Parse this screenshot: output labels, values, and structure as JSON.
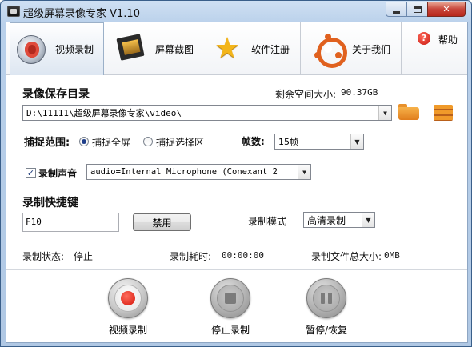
{
  "window": {
    "title": "超级屏幕录像专家 V1.10",
    "close_label": "✕"
  },
  "tabs": [
    {
      "label": "视频录制",
      "icon": "video-record-icon",
      "active": true
    },
    {
      "label": "屏幕截图",
      "icon": "film-clapper-icon",
      "active": false
    },
    {
      "label": "软件注册",
      "icon": "star-icon",
      "active": false
    },
    {
      "label": "关于我们",
      "icon": "ubuntu-logo-icon",
      "active": false
    }
  ],
  "help": {
    "label": "帮助",
    "icon": "help-icon",
    "glyph": "?"
  },
  "save_dir": {
    "title": "录像保存目录",
    "free_space_label": "剩余空间大小:",
    "free_space_value": "90.37GB",
    "path": "D:\\11111\\超级屏幕录像专家\\video\\",
    "browse_icon": "folder-icon",
    "open_icon": "open-folder-icon"
  },
  "capture": {
    "label": "捕捉范围:",
    "options": [
      {
        "label": "捕捉全屏",
        "checked": true
      },
      {
        "label": "捕捉选择区",
        "checked": false
      }
    ],
    "fps_label": "帧数:",
    "fps_value": "15帧"
  },
  "audio": {
    "checkbox_label": "录制声音",
    "checked": true,
    "device": "audio=Internal Microphone (Conexant 2"
  },
  "hotkey": {
    "title": "录制快捷键",
    "value": "F10",
    "disable_button": "禁用",
    "mode_label": "录制模式",
    "mode_value": "高清录制"
  },
  "status": {
    "state_label": "录制状态:",
    "state_value": "停止",
    "elapsed_label": "录制耗时:",
    "elapsed_value": "00:00:00",
    "size_label": "录制文件总大小:",
    "size_value": "0MB"
  },
  "controls": [
    {
      "label": "视频录制",
      "icon": "record-icon"
    },
    {
      "label": "停止录制",
      "icon": "stop-icon"
    },
    {
      "label": "暂停/恢复",
      "icon": "pause-icon"
    }
  ],
  "colors": {
    "title_gradient": "#b9d0ea",
    "accent_orange": "#e07d1c",
    "record_red": "#d4140a"
  }
}
